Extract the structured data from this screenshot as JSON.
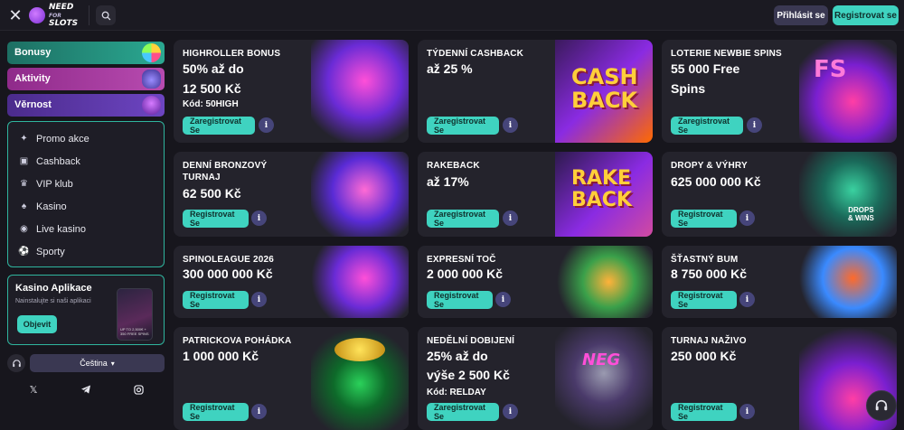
{
  "header": {
    "logo_text_top": "NEED",
    "logo_text_bottom": "SLOTS",
    "logo_text_small": "FOR",
    "login_label": "Přihlásit se",
    "register_label": "Registrovat se"
  },
  "sidebar": {
    "categories": [
      {
        "label": "Bonusy",
        "icon": "wheel-icon"
      },
      {
        "label": "Aktivity",
        "icon": "gamepad-icon"
      },
      {
        "label": "Věrnost",
        "icon": "trophy-icon"
      }
    ],
    "menu": [
      {
        "label": "Promo akce",
        "icon": "promo-icon"
      },
      {
        "label": "Cashback",
        "icon": "cashback-icon"
      },
      {
        "label": "VIP klub",
        "icon": "crown-icon"
      },
      {
        "label": "Kasino",
        "icon": "spade-icon"
      },
      {
        "label": "Live kasino",
        "icon": "live-icon"
      },
      {
        "label": "Sporty",
        "icon": "ball-icon"
      }
    ],
    "app": {
      "title": "Kasino Aplikace",
      "subtitle": "Nainstalujte si naši aplikaci",
      "button": "Objevit",
      "phone_text": "UP TO 2,500€ + 350 FREE SPINS"
    },
    "language": "Čeština",
    "socials": [
      "x-icon",
      "telegram-icon",
      "instagram-icon"
    ]
  },
  "cards": [
    {
      "title": "HIGHROLLER BONUS",
      "lines": [
        "50% až do",
        "12 500 Kč"
      ],
      "code": "Kód: 50HIGH",
      "cta": "Zaregistrovat Se",
      "art": "highroller-art"
    },
    {
      "title": "TÝDENNÍ CASHBACK",
      "lines": [
        "až 25 %"
      ],
      "code": "",
      "cta": "Zaregistrovat Se",
      "art": "cashback-art",
      "art_text_1": "CASH",
      "art_text_2": "BACK"
    },
    {
      "title": "LOTERIE NEWBIE SPINS",
      "lines": [
        "55 000 Free",
        "Spins"
      ],
      "code": "",
      "cta": "Zaregistrovat Se",
      "art": "fs-art",
      "art_text_1": "FS"
    },
    {
      "title": "DENNÍ BRONZOVÝ",
      "title2": "TURNAJ",
      "lines": [
        "62 500 Kč"
      ],
      "code": "",
      "cta": "Registrovat Se",
      "art": "bronze-art"
    },
    {
      "title": "RAKEBACK",
      "lines": [
        "až 17%"
      ],
      "code": "",
      "cta": "Zaregistrovat Se",
      "art": "rakeback-art",
      "art_text_1": "RAKE",
      "art_text_2": "BACK"
    },
    {
      "title": "DROPY & VÝHRY",
      "lines": [
        "625 000 000 Kč"
      ],
      "code": "",
      "cta": "Registrovat Se",
      "art": "drops-art",
      "art_text_1": "DROPS",
      "art_text_2": "& WINS"
    },
    {
      "title": "SPINOLEAGUE 2026",
      "lines": [
        "300 000 000 Kč"
      ],
      "code": "",
      "cta": "Registrovat Se",
      "art": "spinoleague-art"
    },
    {
      "title": "EXPRESNÍ TOČ",
      "lines": [
        "2 000 000 Kč"
      ],
      "code": "",
      "cta": "Registrovat Se",
      "art": "express-art"
    },
    {
      "title": "ŠŤASTNÝ BUM",
      "lines": [
        "8 750 000 Kč"
      ],
      "code": "",
      "cta": "Registrovat Se",
      "art": "jester-art"
    },
    {
      "title": "PATRICKOVA POHÁDKA",
      "lines": [
        "1 000 000 Kč"
      ],
      "code": "",
      "cta": "Registrovat Se",
      "art": "pot-art"
    },
    {
      "title": "NEDĚLNÍ DOBIJENÍ",
      "lines": [
        "25% až do",
        "výše 2 500 Kč"
      ],
      "code": "Kód: RELDAY",
      "cta": "Zaregistrovat Se",
      "art": "trophy-art",
      "art_text_1": "NEG"
    },
    {
      "title": "TURNAJ NAŽIVO",
      "lines": [
        "250 000 Kč"
      ],
      "code": "",
      "cta": "Registrovat Se",
      "art": "roulette-art"
    }
  ],
  "info_glyph": "i",
  "colors": {
    "accent": "#3fd3c0",
    "background": "#17161d",
    "card": "#24232c",
    "info": "#46457a"
  }
}
